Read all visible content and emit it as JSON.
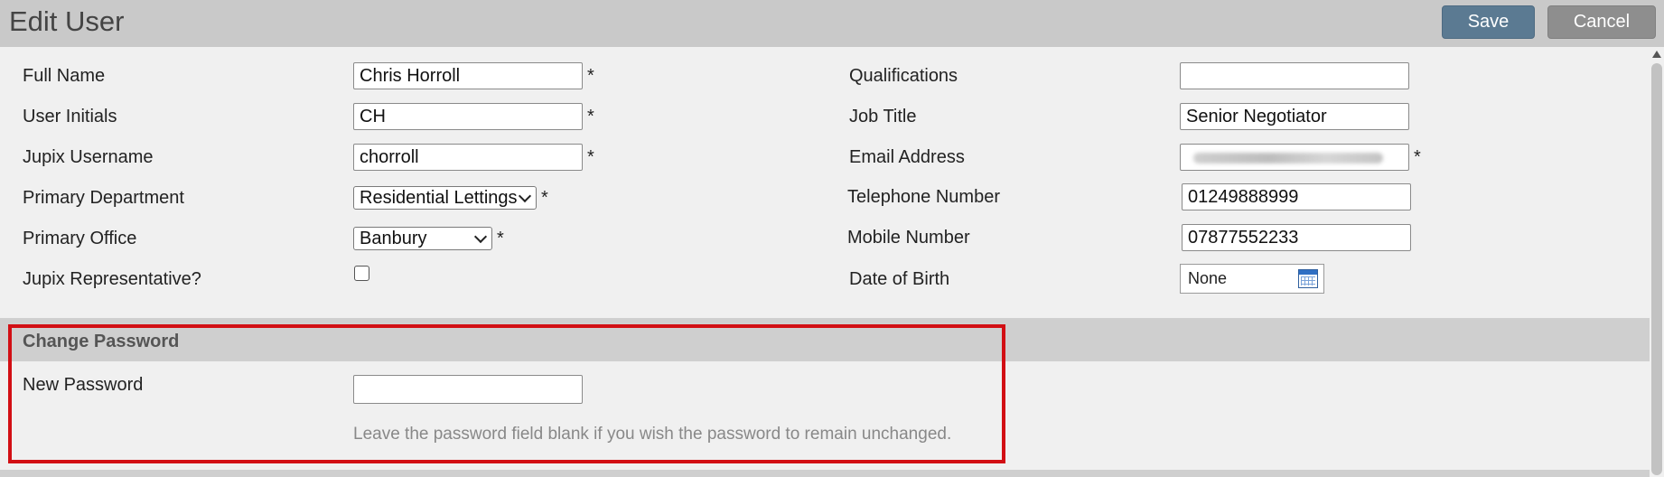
{
  "header": {
    "title": "Edit User",
    "save_label": "Save",
    "cancel_label": "Cancel"
  },
  "left": {
    "full_name_label": "Full Name",
    "full_name_value": "Chris Horroll",
    "initials_label": "User Initials",
    "initials_value": "CH",
    "username_label": "Jupix Username",
    "username_value": "chorroll",
    "department_label": "Primary Department",
    "department_value": "Residential Lettings",
    "office_label": "Primary Office",
    "office_value": "Banbury",
    "representative_label": "Jupix Representative?",
    "representative_checked": false
  },
  "right": {
    "qualifications_label": "Qualifications",
    "qualifications_value": "",
    "job_title_label": "Job Title",
    "job_title_value": "Senior Negotiator",
    "email_label": "Email Address",
    "email_value_obscured": true,
    "telephone_label": "Telephone Number",
    "telephone_value": "01249888999",
    "mobile_label": "Mobile Number",
    "mobile_value": "07877552233",
    "dob_label": "Date of Birth",
    "dob_value": "None"
  },
  "required_marker": "*",
  "password": {
    "section_title": "Change Password",
    "new_password_label": "New Password",
    "new_password_value": "",
    "hint": "Leave the password field blank if you wish the password to remain unchanged."
  },
  "colors": {
    "save_button": "#5b7a92",
    "cancel_button": "#8e8e8e",
    "highlight_border": "#d20f14",
    "header_bg": "#c9c9c9"
  }
}
